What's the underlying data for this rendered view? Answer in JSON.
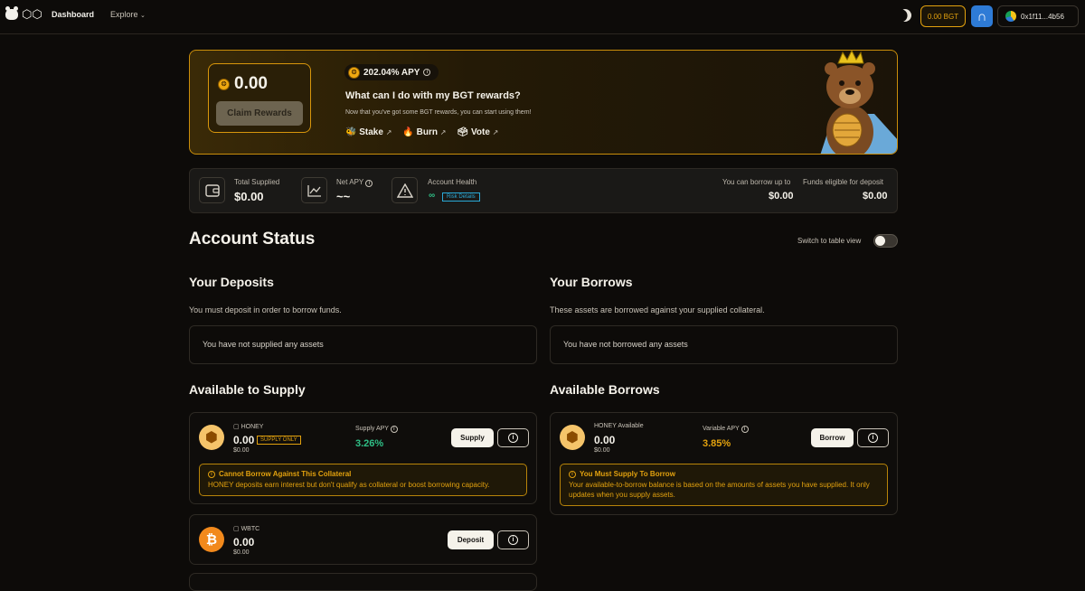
{
  "nav": {
    "dashboard": "Dashboard",
    "explore": "Explore"
  },
  "header": {
    "bgt_balance": "0.00 BGT",
    "wallet_address": "0x1f11...4b56"
  },
  "banner": {
    "claim_amount": "0.00",
    "claim_button": "Claim Rewards",
    "apy": "202.04% APY",
    "title": "What can I do with my BGT rewards?",
    "subtitle": "Now that you've got some BGT rewards, you can start using them!",
    "links": {
      "stake": "Stake",
      "burn": "Burn",
      "vote": "Vote"
    }
  },
  "stats": {
    "total_supplied_label": "Total Supplied",
    "total_supplied": "$0.00",
    "net_apy_label": "Net APY",
    "net_apy": "~~",
    "health_label": "Account Health",
    "health_value": "∞",
    "risk_details": "Risk Details",
    "borrow_up_to_label": "You can borrow up to",
    "borrow_up_to": "$0.00",
    "funds_eligible_label": "Funds eligible for deposit",
    "funds_eligible": "$0.00"
  },
  "account": {
    "title": "Account Status",
    "switch_label": "Switch to table view",
    "deposits_title": "Your Deposits",
    "deposits_sub": "You must deposit in order to borrow funds.",
    "deposits_empty": "You have not supplied any assets",
    "borrows_title": "Your Borrows",
    "borrows_sub": "These assets are borrowed against your supplied collateral.",
    "borrows_empty": "You have not borrowed any assets"
  },
  "supply": {
    "title": "Available to Supply",
    "honey": {
      "symbol": "HONEY",
      "amount": "0.00",
      "usd": "$0.00",
      "badge": "SUPPLY ONLY",
      "apy_label": "Supply APY",
      "apy": "3.26%",
      "button": "Supply",
      "warn_title": "Cannot Borrow Against This Collateral",
      "warn_text": "HONEY deposits earn interest but don't qualify as collateral or boost borrowing capacity."
    },
    "wbtc": {
      "symbol": "WBTC",
      "amount": "0.00",
      "usd": "$0.00",
      "button": "Deposit"
    }
  },
  "borrows": {
    "title": "Available Borrows",
    "honey": {
      "label": "HONEY Available",
      "amount": "0.00",
      "usd": "$0.00",
      "apy_label": "Variable APY",
      "apy": "3.85%",
      "button": "Borrow",
      "warn_title": "You Must Supply To Borrow",
      "warn_text": "Your available-to-borrow balance is based on the amounts of assets you have supplied. It only updates when you supply assets."
    }
  },
  "colors": {
    "accent": "#e2a10e",
    "positive": "#2fbf86",
    "borrow_apy": "#e2a10e"
  }
}
